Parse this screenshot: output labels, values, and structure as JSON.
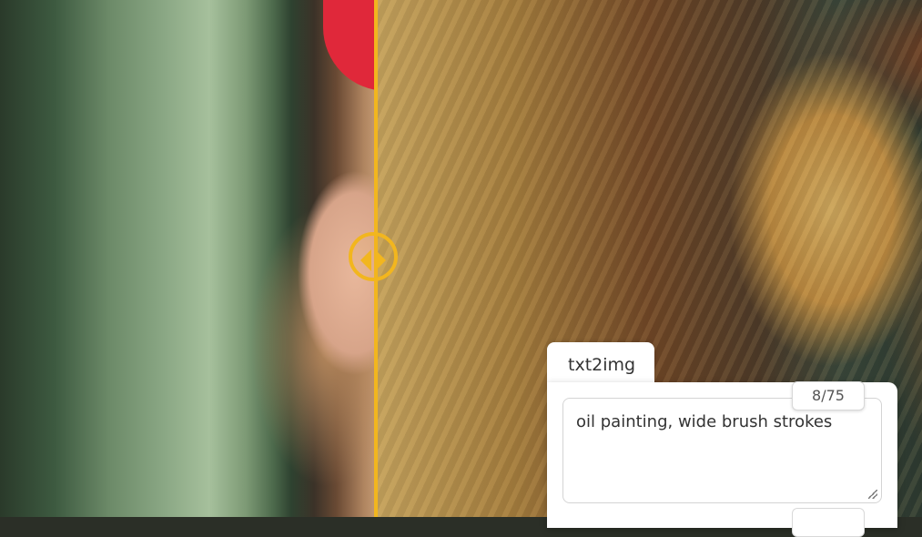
{
  "tab": {
    "label": "txt2img"
  },
  "prompt": {
    "text": "oil painting, wide brush strokes"
  },
  "token_counter": {
    "value": "8/75"
  },
  "colors": {
    "accent": "#f2b61e",
    "panel": "#ffffff"
  },
  "comparison_slider": {
    "position_fraction": 0.41
  }
}
